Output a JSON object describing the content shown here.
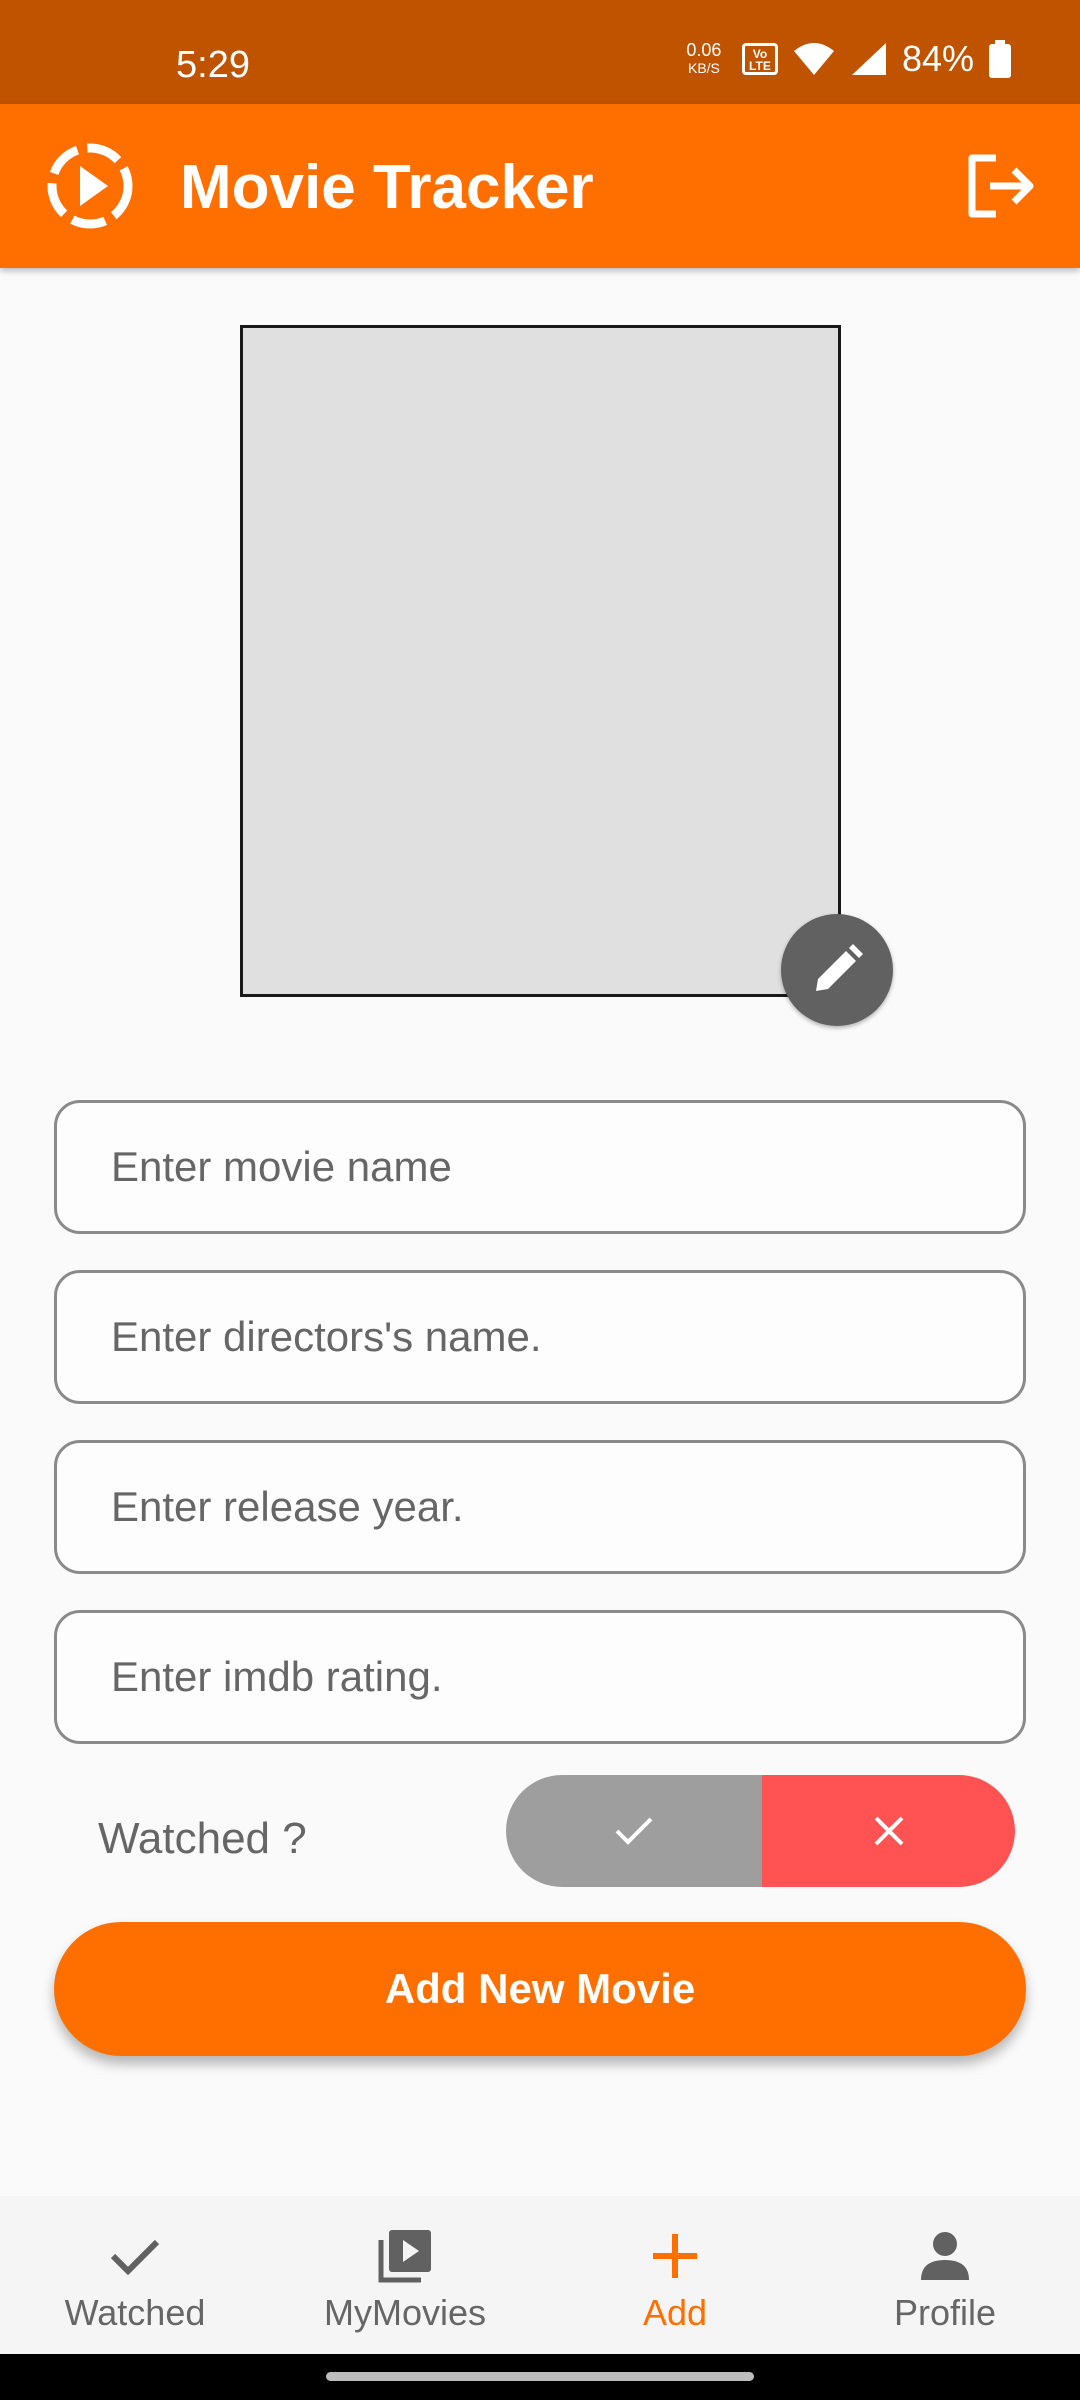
{
  "status_bar": {
    "time": "5:29",
    "net_speed_value": "0.06",
    "net_speed_unit": "KB/S",
    "volte_label": "Vo LTE",
    "battery": "84%"
  },
  "app_bar": {
    "title": "Movie Tracker",
    "logo_icon": "play-circle-dashed-icon",
    "logout_icon": "logout-icon"
  },
  "poster": {
    "edit_icon": "pencil-icon"
  },
  "form": {
    "movie_name_placeholder": "Enter movie name",
    "director_placeholder": "Enter directors's name.",
    "release_year_placeholder": "Enter release year.",
    "imdb_rating_placeholder": "Enter imdb rating."
  },
  "watched": {
    "label": "Watched ?",
    "yes_icon": "check-icon",
    "no_icon": "close-icon"
  },
  "add_button_label": "Add New Movie",
  "bottom_nav": {
    "items": [
      {
        "label": "Watched",
        "icon": "check-icon",
        "active": false
      },
      {
        "label": "MyMovies",
        "icon": "video-library-icon",
        "active": false
      },
      {
        "label": "Add",
        "icon": "plus-icon",
        "active": true
      },
      {
        "label": "Profile",
        "icon": "person-icon",
        "active": false
      }
    ]
  },
  "colors": {
    "status_bar": "#bf5300",
    "accent": "#ff6f00",
    "toggle_yes": "#9e9e9e",
    "toggle_no": "#ff5252",
    "poster_placeholder": "#e0e0e0"
  }
}
